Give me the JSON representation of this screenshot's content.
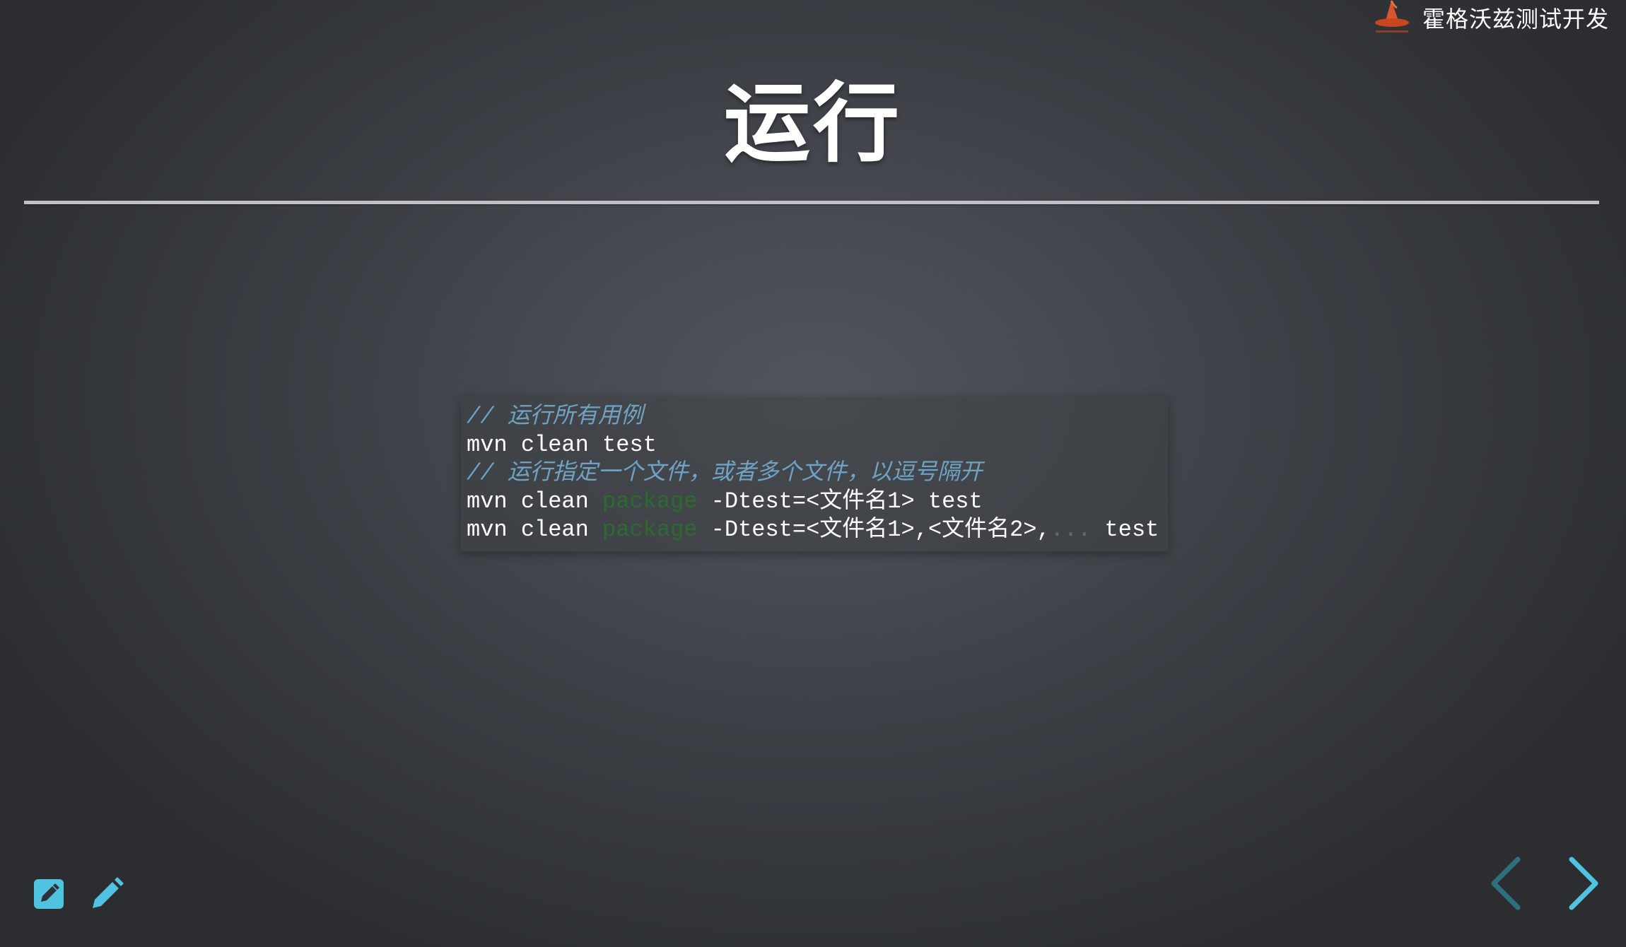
{
  "brand": {
    "logo_icon": "witch-hat-icon",
    "name": "霍格沃兹测试开发"
  },
  "slide": {
    "title": "运行"
  },
  "code": {
    "lines": [
      {
        "parts": [
          {
            "text": "// 运行所有用例",
            "kind": "comment"
          }
        ]
      },
      {
        "parts": [
          {
            "text": "mvn clean test",
            "kind": "plain"
          }
        ]
      },
      {
        "parts": [
          {
            "text": "// 运行指定一个文件，或者多个文件，以逗号隔开",
            "kind": "comment"
          }
        ]
      },
      {
        "parts": [
          {
            "text": "mvn clean ",
            "kind": "plain"
          },
          {
            "text": "package",
            "kind": "keyword"
          },
          {
            "text": " -Dtest=<文件名1> test",
            "kind": "plain"
          }
        ]
      },
      {
        "parts": [
          {
            "text": "mvn clean ",
            "kind": "plain"
          },
          {
            "text": "package",
            "kind": "keyword"
          },
          {
            "text": " -Dtest=<文件名1>,<文件名2>,",
            "kind": "plain"
          },
          {
            "text": "...",
            "kind": "dim"
          },
          {
            "text": " test",
            "kind": "plain"
          }
        ]
      }
    ]
  },
  "toolbar": {
    "edit_icon": "edit-square-icon",
    "pen_icon": "pencil-icon"
  },
  "navigation": {
    "prev_icon": "chevron-left-icon",
    "next_icon": "chevron-right-icon"
  },
  "colors": {
    "accent": "#4fc3e0",
    "accent_dim": "#2f6f7e",
    "comment": "#6fa3c3",
    "keyword": "#2c6b2f"
  }
}
